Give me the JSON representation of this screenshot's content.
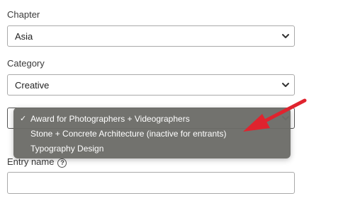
{
  "chapter": {
    "label": "Chapter",
    "value": "Asia"
  },
  "category": {
    "label": "Category",
    "value": "Creative"
  },
  "award_dropdown": {
    "options": [
      "Award for Photographers + Videographers",
      "Stone + Concrete Architecture (inactive for entrants)",
      "Typography Design"
    ],
    "selected_mark": "✓"
  },
  "entry_name": {
    "label": "Entry name",
    "help_icon": "?"
  },
  "colors": {
    "dropdown_bg": "#6c6c68",
    "arrow": "#e0232e"
  },
  "icons": {
    "select_chevron": "chevron-down-icon",
    "help": "question-circle-icon",
    "annotation": "red-arrow-icon"
  }
}
